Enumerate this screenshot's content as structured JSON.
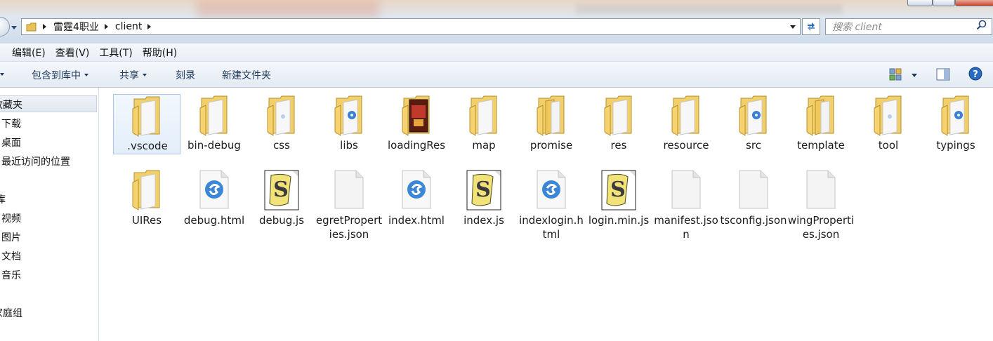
{
  "address_bar": {
    "breadcrumbs": [
      "雷霆4职业",
      "client"
    ]
  },
  "search": {
    "placeholder": "搜索 client"
  },
  "menu": {
    "items": [
      "编辑(E)",
      "查看(V)",
      "工具(T)",
      "帮助(H)"
    ]
  },
  "toolbar": {
    "include_in_library": "包含到库中",
    "share": "共享",
    "burn": "刻录",
    "new_folder": "新建文件夹"
  },
  "nav_pane": {
    "favorites": "收藏夹",
    "downloads": "下载",
    "desktop": "桌面",
    "recent_places": "最近访问的位置",
    "libraries": "库",
    "videos": "视频",
    "pictures": "图片",
    "documents": "文档",
    "music": "音乐",
    "homegroup": "家庭组"
  },
  "files": [
    {
      "name": ".vscode",
      "kind": "folder-plain",
      "selected": true
    },
    {
      "name": "bin-debug",
      "kind": "folder-plain"
    },
    {
      "name": "css",
      "kind": "folder-doc"
    },
    {
      "name": "libs",
      "kind": "folder-media"
    },
    {
      "name": "loadingRes",
      "kind": "folder-image"
    },
    {
      "name": "map",
      "kind": "folder-plain"
    },
    {
      "name": "promise",
      "kind": "folder-stack"
    },
    {
      "name": "res",
      "kind": "folder-plain"
    },
    {
      "name": "resource",
      "kind": "folder-plain"
    },
    {
      "name": "src",
      "kind": "folder-media"
    },
    {
      "name": "template",
      "kind": "folder-stack"
    },
    {
      "name": "tool",
      "kind": "folder-doc"
    },
    {
      "name": "typings",
      "kind": "folder-media"
    },
    {
      "name": "UIRes",
      "kind": "folder-plain"
    },
    {
      "name": "debug.html",
      "kind": "html-file"
    },
    {
      "name": "debug.js",
      "kind": "js-file"
    },
    {
      "name": "egretProperties.json",
      "kind": "blank-file"
    },
    {
      "name": "index.html",
      "kind": "html-file"
    },
    {
      "name": "index.js",
      "kind": "js-file"
    },
    {
      "name": "indexlogin.html",
      "kind": "html-file"
    },
    {
      "name": "login.min.js",
      "kind": "js-file"
    },
    {
      "name": "manifest.json",
      "kind": "blank-file"
    },
    {
      "name": "tsconfig.json",
      "kind": "blank-file"
    },
    {
      "name": "wingProperties.json",
      "kind": "blank-file"
    }
  ],
  "colors": {
    "folder": "#f1cf6b",
    "accent": "#2a6bc2",
    "selection": "#cde3f8"
  }
}
